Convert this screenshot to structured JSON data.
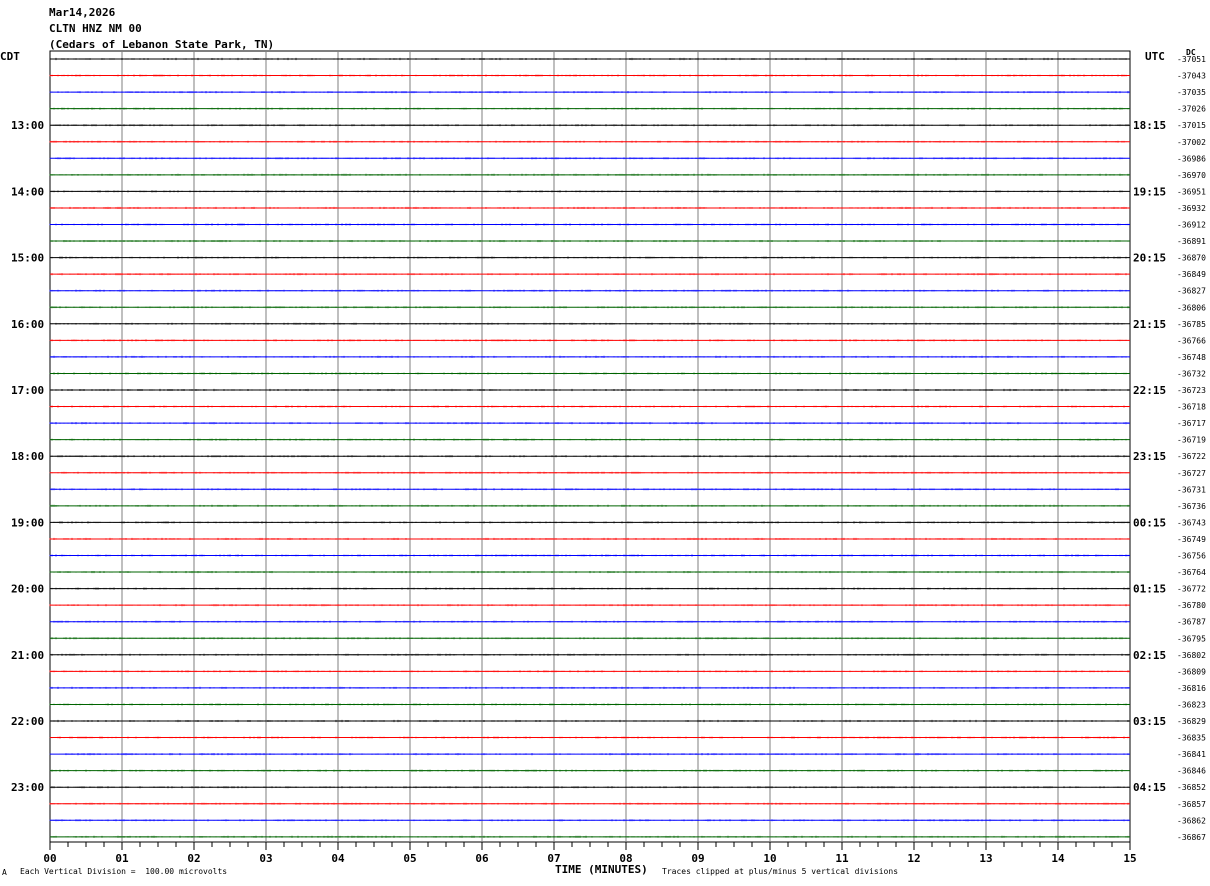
{
  "header": {
    "date": "Mar14,2026",
    "station": "CLTN HNZ NM 00",
    "location": "(Cedars of Lebanon State Park, TN)"
  },
  "left_axis_label": "CDT",
  "right_axis_label": "UTC",
  "right_corner_label": "DC",
  "footer": {
    "scale_note": "Each Vertical Division =  100.00 microvolts",
    "xlabel": "TIME (MINUTES)",
    "clip_note": "Traces clipped at plus/minus 5 vertical divisions",
    "corner_mark": "A"
  },
  "colors": {
    "trace_cycle": [
      "#000000",
      "#ff0000",
      "#0000ff",
      "#006400"
    ],
    "grid": "#000000",
    "minute_grid": "#000080"
  },
  "chart_data": {
    "type": "line",
    "title": "",
    "xlabel": "TIME (MINUTES)",
    "xlim": [
      0,
      15
    ],
    "x_ticks": [
      "00",
      "01",
      "02",
      "03",
      "04",
      "05",
      "06",
      "07",
      "08",
      "09",
      "10",
      "11",
      "12",
      "13",
      "14",
      "15"
    ],
    "rows_per_hour": 4,
    "left_hour_labels": [
      {
        "row": 4,
        "label": "13:00"
      },
      {
        "row": 8,
        "label": "14:00"
      },
      {
        "row": 12,
        "label": "15:00"
      },
      {
        "row": 16,
        "label": "16:00"
      },
      {
        "row": 20,
        "label": "17:00"
      },
      {
        "row": 24,
        "label": "18:00"
      },
      {
        "row": 28,
        "label": "19:00"
      },
      {
        "row": 32,
        "label": "20:00"
      },
      {
        "row": 36,
        "label": "21:00"
      },
      {
        "row": 40,
        "label": "22:00"
      },
      {
        "row": 44,
        "label": "23:00"
      }
    ],
    "right_hour_labels": [
      {
        "row": 4,
        "label": "18:15"
      },
      {
        "row": 8,
        "label": "19:15"
      },
      {
        "row": 12,
        "label": "20:15"
      },
      {
        "row": 16,
        "label": "21:15"
      },
      {
        "row": 20,
        "label": "22:15"
      },
      {
        "row": 24,
        "label": "23:15"
      },
      {
        "row": 28,
        "label": "00:15"
      },
      {
        "row": 32,
        "label": "01:15"
      },
      {
        "row": 36,
        "label": "02:15"
      },
      {
        "row": 40,
        "label": "03:15"
      },
      {
        "row": 44,
        "label": "04:15"
      }
    ],
    "dc_offsets": [
      "-37051",
      "-37043",
      "-37035",
      "-37026",
      "-37015",
      "-37002",
      "-36986",
      "-36970",
      "-36951",
      "-36932",
      "-36912",
      "-36891",
      "-36870",
      "-36849",
      "-36827",
      "-36806",
      "-36785",
      "-36766",
      "-36748",
      "-36732",
      "-36723",
      "-36718",
      "-36717",
      "-36719",
      "-36722",
      "-36727",
      "-36731",
      "-36736",
      "-36743",
      "-36749",
      "-36756",
      "-36764",
      "-36772",
      "-36780",
      "-36787",
      "-36795",
      "-36802",
      "-36809",
      "-36816",
      "-36823",
      "-36829",
      "-36835",
      "-36841",
      "-36846",
      "-36852",
      "-36857",
      "-36862",
      "-36867"
    ]
  }
}
